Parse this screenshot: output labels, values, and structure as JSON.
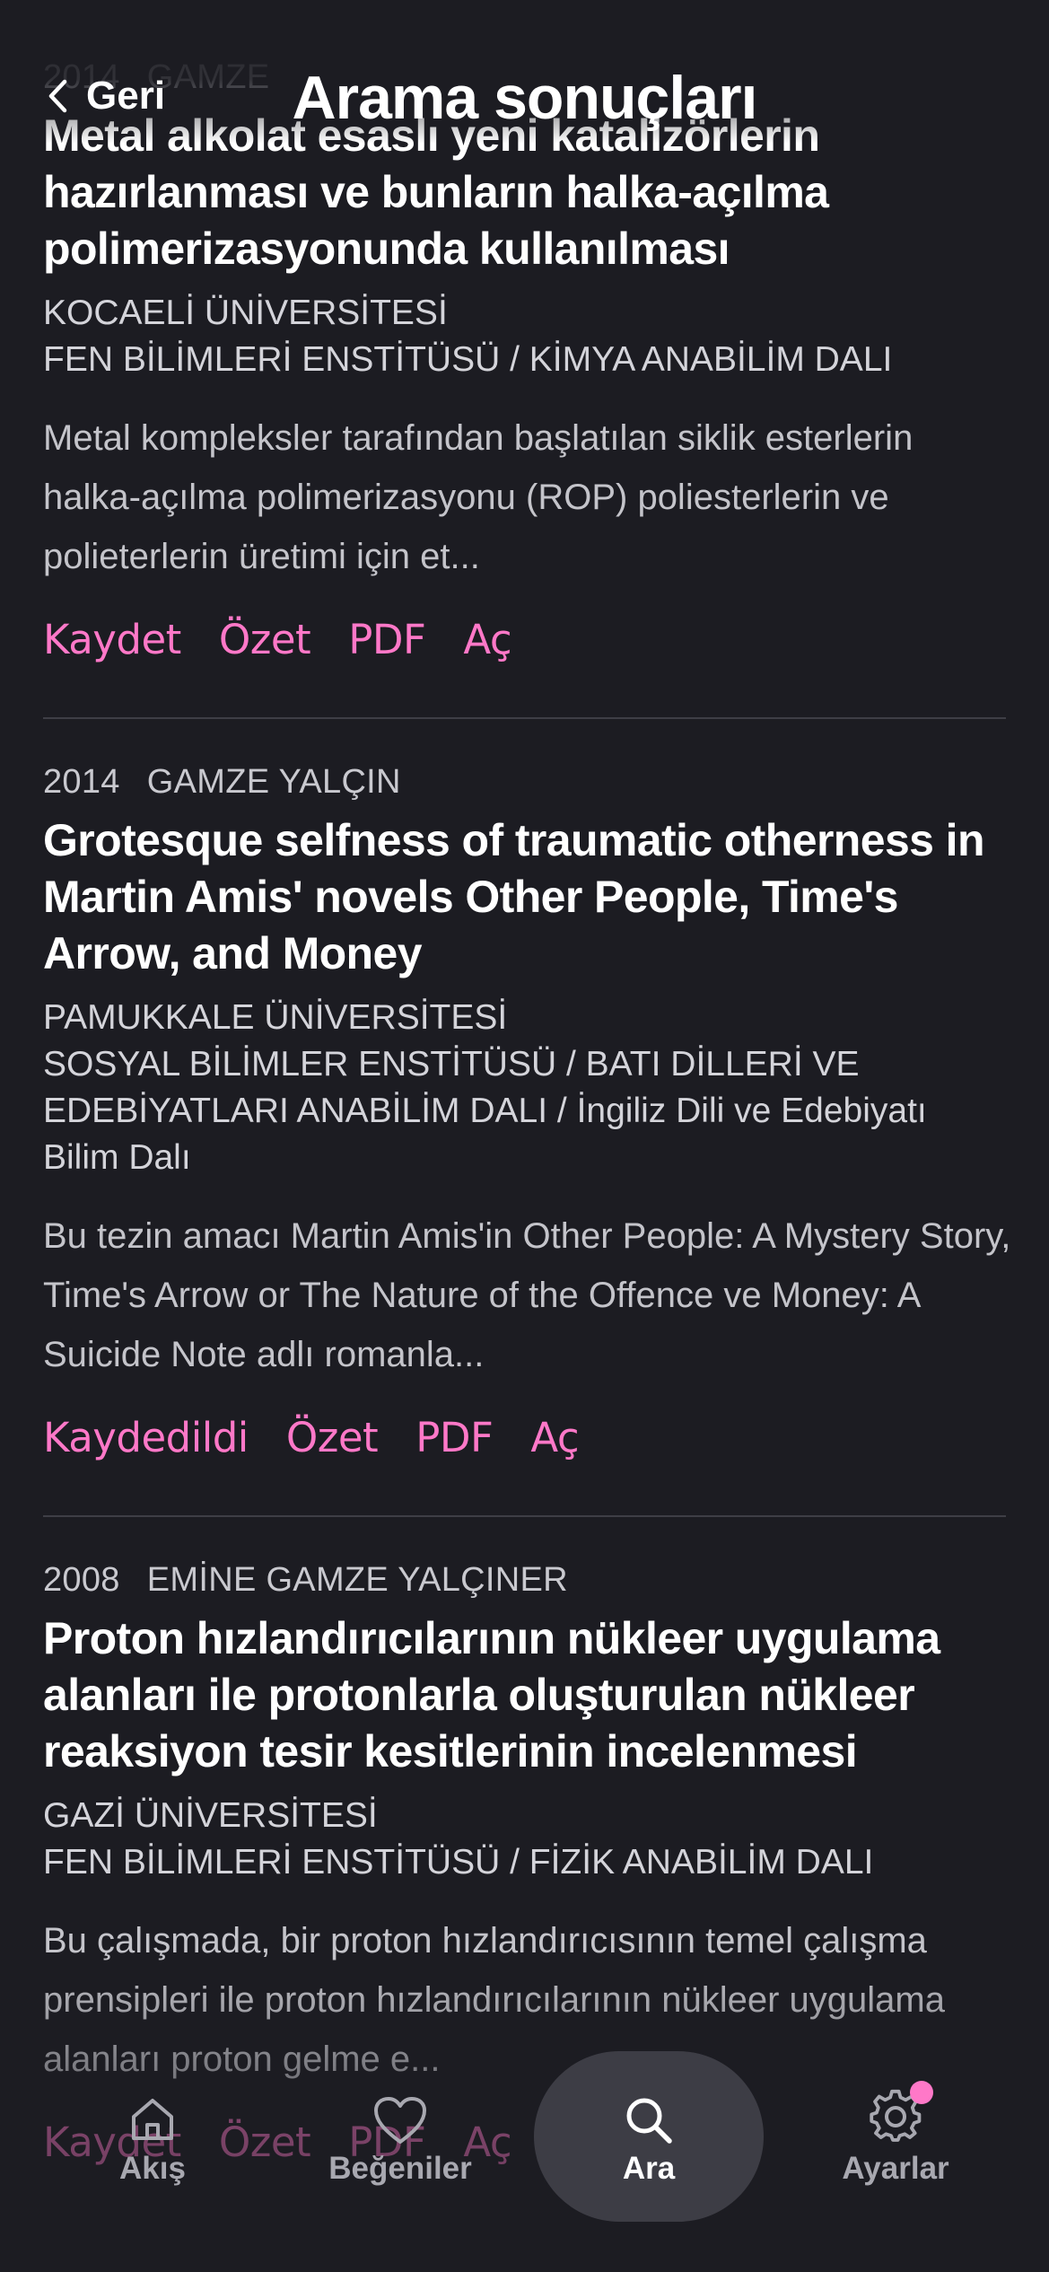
{
  "header": {
    "back_label": "Geri",
    "title": "Arama sonuçları"
  },
  "colors": {
    "background": "#1c1c22",
    "accent": "#ff78c8"
  },
  "results": [
    {
      "year": "2014",
      "author": "GAMZE",
      "title": "Metal alkolat esaslı yeni katalizörlerin hazırlanması ve bunların halka-açılma polimerizasyonunda kullanılması",
      "institution": "KOCAELİ ÜNİVERSİTESİ",
      "department": "FEN BİLİMLERİ ENSTİTÜSÜ / KİMYA ANABİLİM DALI",
      "abstract": "Metal kompleksler tarafından başlatılan siklik esterlerin halka-açılma polimerizasyonu (ROP) poliesterlerin ve polieterlerin üretimi için et...",
      "actions": {
        "save": "Kaydet",
        "summary": "Özet",
        "pdf": "PDF",
        "open": "Aç"
      }
    },
    {
      "year": "2014",
      "author": "GAMZE YALÇIN",
      "title": "Grotesque selfness of traumatic otherness in Martin Amis' novels Other People, Time's Arrow, and Money",
      "institution": "PAMUKKALE ÜNİVERSİTESİ",
      "department": "SOSYAL BİLİMLER ENSTİTÜSÜ / BATI DİLLERİ VE EDEBİYATLARI ANABİLİM DALI / İngiliz Dili ve Edebiyatı Bilim Dalı",
      "abstract": "Bu tezin amacı Martin Amis'in Other People: A Mystery Story, Time's Arrow or The Nature of the Offence ve Money: A Suicide Note adlı romanla...",
      "actions": {
        "save": "Kaydedildi",
        "summary": "Özet",
        "pdf": "PDF",
        "open": "Aç"
      }
    },
    {
      "year": "2008",
      "author": "EMİNE GAMZE YALÇINER",
      "title": "Proton hızlandırıcılarının nükleer uygulama alanları ile protonlarla oluşturulan nükleer reaksiyon tesir kesitlerinin incelenmesi",
      "institution": "GAZİ ÜNİVERSİTESİ",
      "department": "FEN BİLİMLERİ ENSTİTÜSÜ / FİZİK ANABİLİM DALI",
      "abstract": "Bu çalışmada, bir proton hızlandırıcısının temel çalışma prensipleri ile proton hızlandırıcılarının nükleer uygulama alanları proton gelme e...",
      "actions": {
        "save": "Kaydet",
        "summary": "Özet",
        "pdf": "PDF",
        "open": "Aç"
      }
    }
  ],
  "tabbar": {
    "tabs": [
      {
        "label": "Akış",
        "icon": "home-icon"
      },
      {
        "label": "Beğeniler",
        "icon": "heart-icon"
      },
      {
        "label": "Ara",
        "icon": "search-icon",
        "active": true
      },
      {
        "label": "Ayarlar",
        "icon": "gear-icon",
        "badge": true
      }
    ]
  }
}
